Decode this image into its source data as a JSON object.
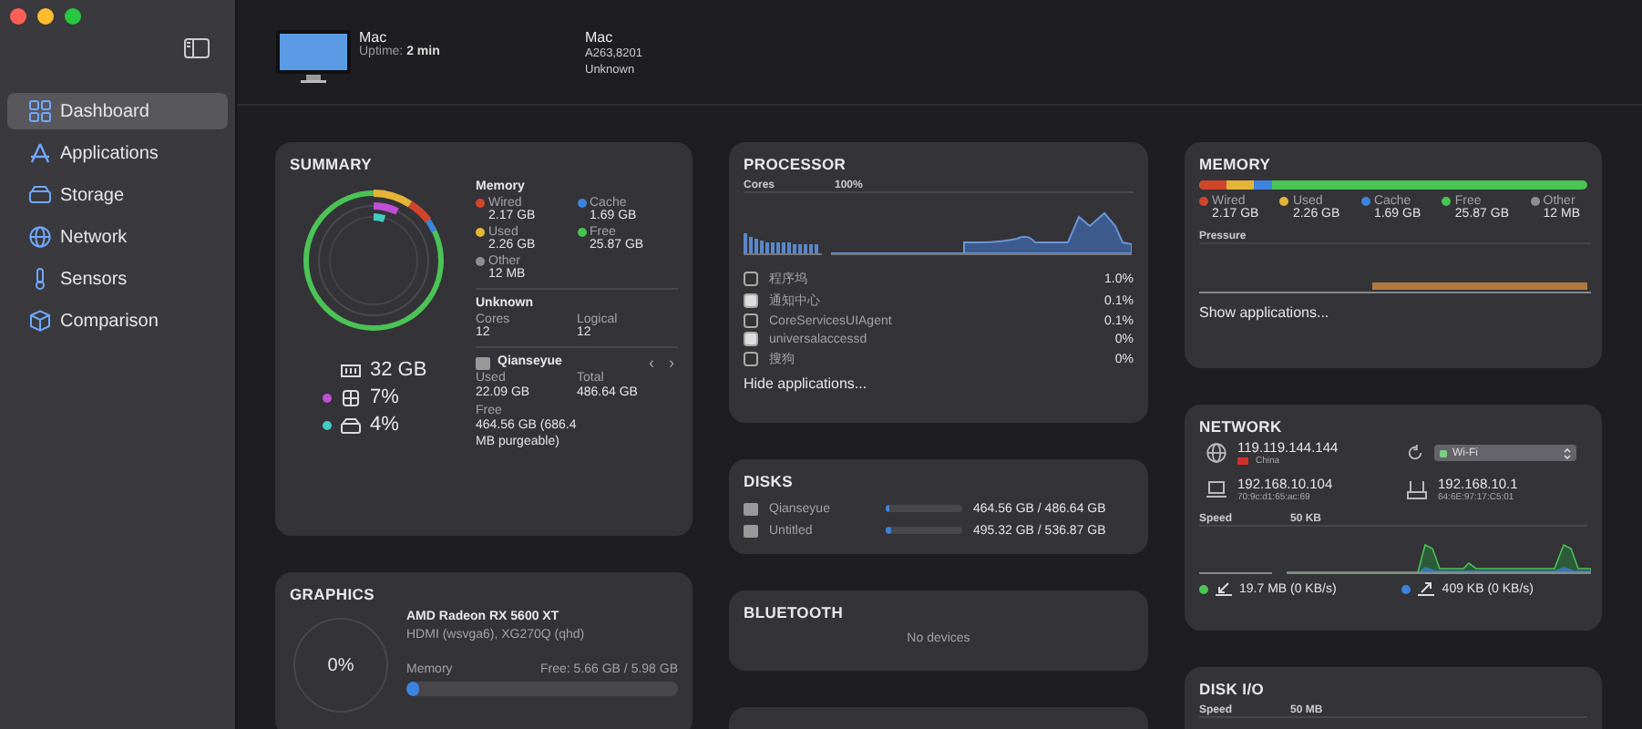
{
  "sidebar": {
    "items": [
      {
        "label": "Dashboard",
        "kind": "grid",
        "selected": true
      },
      {
        "label": "Applications",
        "kind": "apps",
        "selected": false
      },
      {
        "label": "Storage",
        "kind": "drive",
        "selected": false
      },
      {
        "label": "Network",
        "kind": "globe",
        "selected": false
      },
      {
        "label": "Sensors",
        "kind": "thermo",
        "selected": false
      },
      {
        "label": "Comparison",
        "kind": "cube",
        "selected": false
      }
    ]
  },
  "header": {
    "model": "Mac",
    "uptime_label": "Uptime:",
    "uptime": "2 min",
    "info_title": "Mac",
    "info_lines": [
      "A263,8201",
      "Unknown"
    ]
  },
  "summary": {
    "title": "SUMMARY",
    "stats": [
      {
        "kind": "ram",
        "value": "32 GB"
      },
      {
        "kind": "cpu",
        "value": "7%",
        "color": "#c04fd6"
      },
      {
        "kind": "disk",
        "value": "4%",
        "color": "#45cbc0"
      }
    ],
    "memory_heading": "Memory",
    "memory": [
      {
        "label": "Wired",
        "value": "2.17 GB",
        "color": "#d0462a"
      },
      {
        "label": "Cache",
        "value": "1.69 GB",
        "color": "#3d83e0"
      },
      {
        "label": "Used",
        "value": "2.26 GB",
        "color": "#e5b53a"
      },
      {
        "label": "Free",
        "value": "25.87 GB",
        "color": "#48c552"
      },
      {
        "label": "Other",
        "value": "12 MB",
        "color": "#8e8e93"
      }
    ],
    "cpu_heading": "Unknown",
    "cpu": [
      {
        "label": "Cores",
        "value": "12"
      },
      {
        "label": "Logical",
        "value": "12"
      }
    ],
    "disk": {
      "name": "Qianseyue",
      "prev": "‹",
      "next": "›",
      "fields": [
        {
          "label": "Used",
          "value": "22.09 GB"
        },
        {
          "label": "Total",
          "value": "486.64 GB"
        },
        {
          "label": "Free",
          "value": "464.56 GB (686.4 MB purgeable)"
        }
      ]
    }
  },
  "graphics": {
    "title": "GRAPHICS",
    "usage": "0%",
    "name": "AMD Radeon RX 5600 XT",
    "displays": "HDMI (wsvga6), XG270Q (qhd)",
    "memory_label": "Memory",
    "memory_value": "Free: 5.66 GB / 5.98 GB",
    "level": 0.05
  },
  "processor": {
    "title": "PROCESSOR",
    "chart_label": "Cores",
    "chart_max": "100%",
    "apps": [
      {
        "name": "程序坞",
        "value": "1.0%"
      },
      {
        "name": "通知中心",
        "value": "0.1%"
      },
      {
        "name": "CoreServicesUIAgent",
        "value": "0.1%"
      },
      {
        "name": "universalaccessd",
        "value": "0%"
      },
      {
        "name": "搜狗",
        "value": "0%"
      }
    ],
    "link": "Hide applications..."
  },
  "disks": {
    "title": "DISKS",
    "items": [
      {
        "name": "Qianseyue",
        "level": 0.05,
        "value": "464.56 GB / 486.64 GB"
      },
      {
        "name": "Untitled",
        "level": 0.08,
        "value": "495.32 GB / 536.87 GB"
      }
    ]
  },
  "bluetooth": {
    "title": "BLUETOOTH",
    "empty": "No devices"
  },
  "memory": {
    "title": "MEMORY",
    "legend": [
      {
        "label": "Wired",
        "value": "2.17 GB",
        "color": "#d0462a"
      },
      {
        "label": "Used",
        "value": "2.26 GB",
        "color": "#e5b53a"
      },
      {
        "label": "Cache",
        "value": "1.69 GB",
        "color": "#3d83e0"
      },
      {
        "label": "Free",
        "value": "25.87 GB",
        "color": "#48c552"
      },
      {
        "label": "Other",
        "value": "12 MB",
        "color": "#8e8e93"
      }
    ],
    "pressure_label": "Pressure",
    "link": "Show applications..."
  },
  "network": {
    "title": "NETWORK",
    "public_ip": "119.119.144.144",
    "country": "China",
    "interface": "Wi-Fi",
    "local_ip": "192.168.10.104",
    "local_mac": "70:9c:d1:65:ac:69",
    "router_ip": "192.168.10.1",
    "router_mac": "64:6E:97:17:C5:01",
    "speed_label": "Speed",
    "speed_max": "50 KB",
    "download": {
      "value": "19.7 MB (0 KB/s)",
      "color": "#48c552"
    },
    "upload": {
      "value": "409 KB (0 KB/s)",
      "color": "#3d83e0"
    }
  },
  "disk_io": {
    "title": "DISK I/O",
    "speed_label": "Speed",
    "speed_max": "50 MB"
  }
}
